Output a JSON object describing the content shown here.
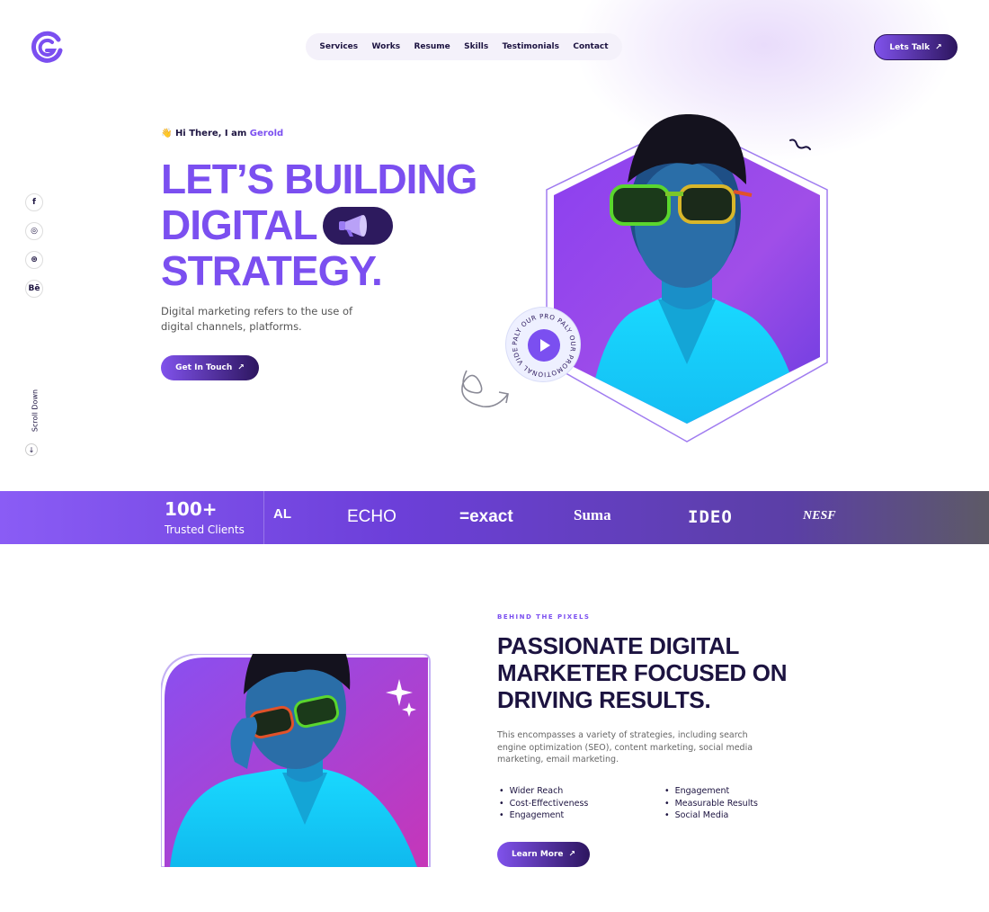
{
  "nav": {
    "items": [
      "Services",
      "Works",
      "Resume",
      "Skills",
      "Testimonials",
      "Contact"
    ],
    "cta": "Lets Talk",
    "arrow": "↗"
  },
  "social": [
    "f",
    "◎",
    "⊛",
    "Bē"
  ],
  "scroll": {
    "label": "Scroll Down",
    "arrow": "↓"
  },
  "hero": {
    "wave": "👋",
    "greeting_prefix": "Hi There, I am ",
    "name": "Gerold",
    "headline": [
      "LET’S BUILDING",
      "DIGITAL",
      "STRATEGY."
    ],
    "description": "Digital marketing refers to the use of digital channels, platforms.",
    "cta": "Get In Touch",
    "badge_text": "PALY OUR PRO PALY OUR PROMOTIONAL VIDEO "
  },
  "clients": {
    "count": "100+",
    "label": "Trusted Clients",
    "brands": [
      "AL",
      "ECHO",
      "=exact",
      "Suma",
      "IDEO",
      "NESF"
    ]
  },
  "about": {
    "eyebrow": "BEHIND THE PIXELS",
    "title": [
      "PASSIONATE DIGITAL",
      "MARKETER FOCUSED ON",
      "DRIVING RESULTS."
    ],
    "description": "This encompasses a variety of strategies, including search engine optimization (SEO), content marketing, social media marketing, email marketing.",
    "list_left": [
      "Wider Reach",
      "Cost-Effectiveness",
      "Engagement"
    ],
    "list_right": [
      "Engagement",
      "Measurable Results",
      "Social Media"
    ],
    "cta": "Learn More"
  },
  "colors": {
    "accent": "#7b4ff0",
    "dark": "#1c1340",
    "strip": "#6c3fd9"
  }
}
